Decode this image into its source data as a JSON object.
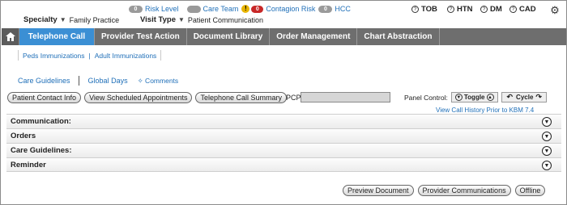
{
  "header": {
    "specialty_label": "Specialty",
    "specialty_value": "Family Practice",
    "visit_type_label": "Visit Type",
    "visit_type_value": "Patient Communication",
    "caret": "▼",
    "indicators": [
      {
        "count": "0",
        "label": "Risk Level"
      },
      {
        "count": "",
        "label": "Care Team"
      },
      {
        "count": "0",
        "label": "Contagion Risk"
      },
      {
        "count": "0",
        "label": "HCC"
      }
    ],
    "warn_glyph": "!",
    "conditions": [
      {
        "icon": "?",
        "label": "TOB"
      },
      {
        "icon": "?",
        "label": "HTN"
      },
      {
        "icon": "?",
        "label": "DM"
      },
      {
        "icon": "?",
        "label": "CAD"
      }
    ]
  },
  "nav": {
    "tabs": [
      "Telephone Call",
      "Provider Test Action",
      "Document Library",
      "Order Management",
      "Chart Abstraction"
    ],
    "active_index": 0
  },
  "subtabs": {
    "items": [
      "Peds Immunizations",
      "Adult Immunizations"
    ],
    "separator": "|"
  },
  "care_links": {
    "care_guidelines": "Care Guidelines",
    "global_days": "Global Days",
    "comments": "✧ Comments"
  },
  "actions": {
    "buttons": [
      "Patient Contact Info",
      "View Scheduled Appointments",
      "Telephone Call Summary"
    ],
    "pcp_label": "PCP:",
    "pcp_value": ""
  },
  "panel_control": {
    "label": "Panel Control:",
    "toggle": "Toggle",
    "cycle": "Cycle",
    "call_history": "View Call History Prior to KBM 7.4"
  },
  "sections": [
    "Communication:",
    "Orders",
    "Care Guidelines:",
    "Reminder"
  ],
  "footer": {
    "buttons": [
      "Preview Document",
      "Provider Communications",
      "Offline"
    ]
  }
}
